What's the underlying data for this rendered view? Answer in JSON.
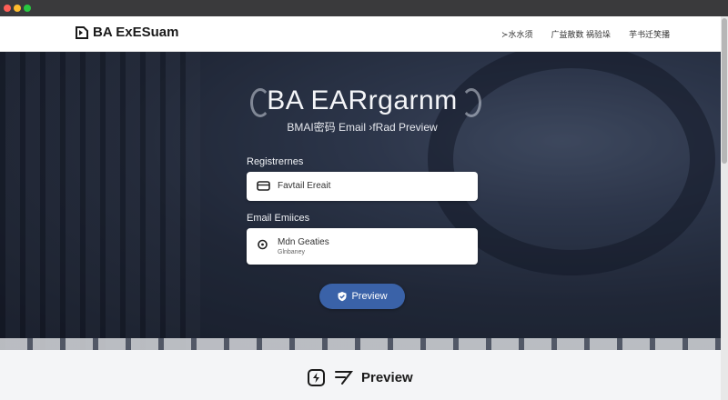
{
  "header": {
    "brand": "BA ExESuam",
    "nav": [
      "≻水水须",
      "广益散数 祸验垛",
      "芋书迁笑播"
    ]
  },
  "hero": {
    "title": "BA EARrgarnm",
    "subtitle": "BMAI密码 Email ›fRad Preview",
    "field1_label": "Registrernes",
    "field1_value": "Favtail Ereait",
    "field2_label": "Email Emiices",
    "field2_value": "Mdn Geaties",
    "field2_hint": "Glnbaney",
    "button_label": "Preview"
  },
  "footer": {
    "label": "Preview"
  },
  "colors": {
    "accent": "#3a62a8"
  }
}
